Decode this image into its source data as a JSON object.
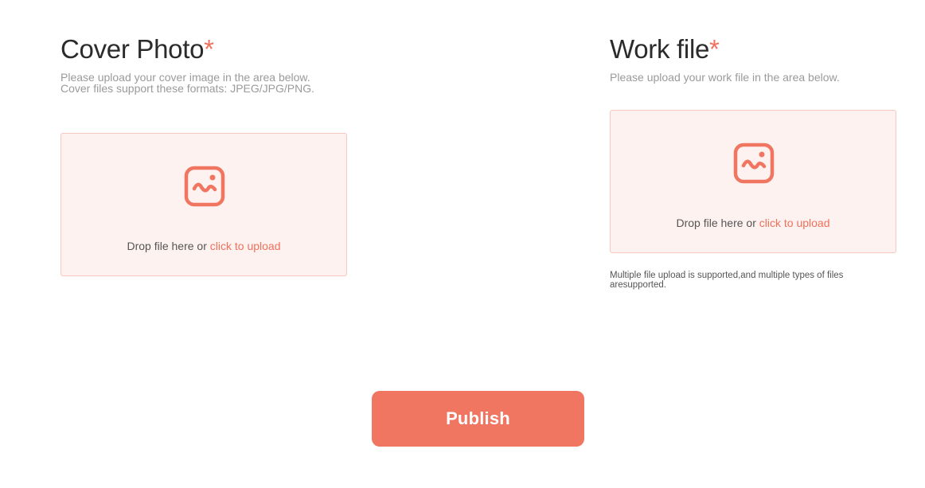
{
  "cover": {
    "title": "Cover Photo",
    "required_mark": "*",
    "hint": "Please upload your cover image in the area below.\nCover files support these formats: JPEG/JPG/PNG.",
    "dropzone": {
      "icon": "image-icon",
      "text": "Drop file here or ",
      "link": "click to upload"
    }
  },
  "work": {
    "title": "Work file",
    "required_mark": "*",
    "hint": "Please upload your work file in the area below.",
    "dropzone": {
      "icon": "image-icon",
      "text": "Drop file here or ",
      "link": "click to upload"
    },
    "note": "Multiple file upload is supported,and multiple types of files aresupported."
  },
  "publish_label": "Publish",
  "colors": {
    "accent": "#f07661",
    "dropzone_bg": "#fdf2f0",
    "dropzone_border": "#f6c8bf"
  }
}
